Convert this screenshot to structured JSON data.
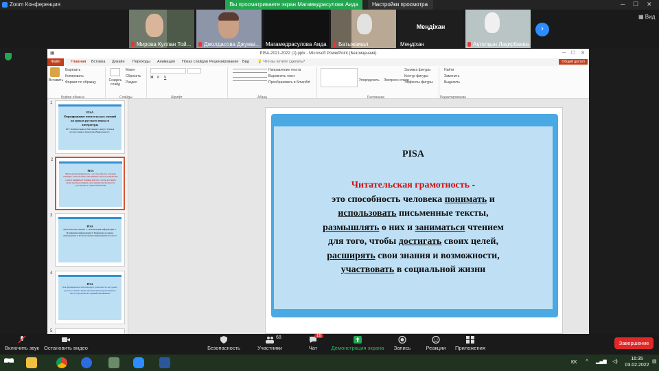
{
  "zoom": {
    "app_title": "Zoom Конференция",
    "share_banner": "Вы просматриваете экран Магамедрасулова Аида",
    "view_settings": "Настройки просмотра",
    "view_label": "Вид"
  },
  "participants": [
    {
      "name": "Мирова Кулпан Той..."
    },
    {
      "name": "Джолдасова Джумаг..."
    },
    {
      "name": "Магамедрасулова Аида"
    },
    {
      "name": "Батыжамал"
    },
    {
      "name": "Меңдіхан",
      "big": "Меңдіхан"
    },
    {
      "name": "Ақтолқын Лақирбаева"
    }
  ],
  "ppt": {
    "title": "PISA-2021-2022 (1).pptx - Microsoft PowerPoint (Безлицензия)",
    "file_tab": "Файл",
    "tabs": [
      "Главная",
      "Вставка",
      "Дизайн",
      "Переходы",
      "Анимация",
      "Показ слайдов",
      "Рецензирование",
      "Вид"
    ],
    "tell_me": "Что вы хотите сделать?",
    "share": "Общий доступ",
    "ribbon": {
      "paste": "Вставить",
      "cut": "Вырезать",
      "copy": "Копировать",
      "format_painter": "Формат по образцу",
      "clipboard": "Буфер обмена",
      "new_slide": "Создать слайд",
      "layout": "Макет",
      "reset": "Сбросить",
      "section": "Раздел",
      "slides": "Слайды",
      "font": "Шрифт",
      "paragraph": "Абзац",
      "text_direction": "Направление текста",
      "align_text": "Выровнять текст",
      "smartart": "Преобразовать в SmartArt",
      "arrange": "Упорядочить",
      "quick_styles": "Экспресс-стили",
      "shape_fill": "Заливка фигуры",
      "shape_outline": "Контур фигуры",
      "shape_effects": "Эффекты фигуры",
      "drawing": "Рисование",
      "find": "Найти",
      "replace": "Заменить",
      "select": "Выделить",
      "editing": "Редактирование"
    }
  },
  "thumbnails": [
    {
      "num": "1",
      "title": "PISA",
      "text": "Формирование читательских умений на уроках русского языка и литературы",
      "sub": "КГУ «Блакбастаршкола №23 имени С.Анчут» Учителя русского языка и литературы Вдаврелова А.С."
    },
    {
      "num": "2",
      "title": "PISA",
      "text": "Читательская грамотность - это способность человека понимать и использовать письменные тексты, размышлять о них и заниматься чтением для того, чтобы достигать своих целей, расширять свои знания и возможности, участвовать в социальной жизни"
    },
    {
      "num": "3",
      "title": "PISA",
      "text": "Читательские умения: 1. Локализация информации 2. Понимание информации 3. Рефлексия и оценка информации 4. Использование информации из текста"
    },
    {
      "num": "4",
      "title": "PISA",
      "text": "Как формировать читательскую грамотность на уроках русского языка? Цели обучения Цели урока Подбор текста и разработка заданий Оценивание"
    },
    {
      "num": "5"
    }
  ],
  "slide": {
    "title": "PISA",
    "red_term": "Читательская грамотность",
    "dash": " -",
    "l2a": "это способность человека ",
    "l2u": "понимать",
    "l2b": " и",
    "l3u": "использовать",
    "l3b": " письменные тексты,",
    "l4u": "размышлять",
    "l4b": " о них и ",
    "l4u2": "заниматься",
    "l4c": " чтением",
    "l5a": "для того, чтобы ",
    "l5u": "достигать",
    "l5b": " своих целей,",
    "l6u": "расширять",
    "l6b": " свои знания и возможности,",
    "l7u": "участвовать",
    "l7b": " в социальной жизни"
  },
  "toolbar": {
    "unmute": "Включить звук",
    "video": "Остановить видео",
    "security": "Безопасность",
    "participants": "Участники",
    "participants_count": "68",
    "chat": "Чат",
    "chat_badge": "16",
    "share": "Демонстрация экрана",
    "record": "Запись",
    "reactions": "Реакции",
    "apps": "Приложения",
    "end": "Завершение"
  },
  "taskbar": {
    "lang": "КК",
    "time": "16:35",
    "date": "03.02.2022"
  },
  "colors": {
    "zoom_green": "#23a650",
    "zoom_blue": "#2d8cff",
    "end_red": "#e02828",
    "ppt_orange": "#c43e1c",
    "slide_blue": "#4aa8e2",
    "slide_panel": "#bfe0f4",
    "term_red": "#d01010"
  }
}
